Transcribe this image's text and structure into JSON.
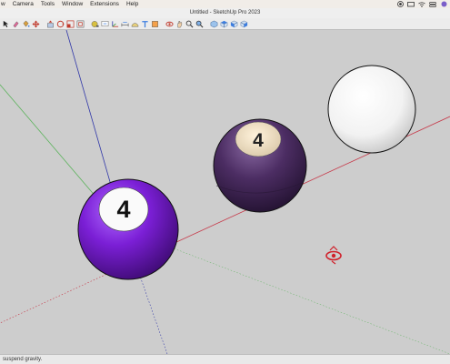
{
  "menubar": {
    "items": [
      "w",
      "Camera",
      "Tools",
      "Window",
      "Extensions",
      "Help"
    ]
  },
  "window": {
    "title": "Untitled - SketchUp Pro 2023"
  },
  "toolbar": {
    "icons": [
      "select-icon",
      "eraser-icon",
      "paint-bucket-icon",
      "move-icon",
      "push-pull-icon",
      "rotate-icon",
      "scale-icon",
      "offset-icon",
      "tape-measure-icon",
      "text-icon",
      "axes-icon",
      "dimension-icon",
      "protractor-icon",
      "3d-text-icon",
      "section-plane-icon",
      "orbit-icon",
      "pan-icon",
      "zoom-icon",
      "zoom-extents-icon",
      "iso-view-icon",
      "top-view-icon",
      "front-view-icon",
      "right-view-icon"
    ]
  },
  "viewport": {
    "balls": [
      {
        "name": "purple-4-ball",
        "number": "4",
        "color": "#7b1fd6"
      },
      {
        "name": "dark-purple-4-ball",
        "number": "4",
        "color": "#4c2d63"
      },
      {
        "name": "white-cue-ball",
        "color": "#f4f4f4"
      }
    ],
    "axis_colors": {
      "red": "#c63a4a",
      "green": "#5db35d",
      "blue": "#2f36a8"
    }
  },
  "statusbar": {
    "text": "suspend gravity."
  }
}
